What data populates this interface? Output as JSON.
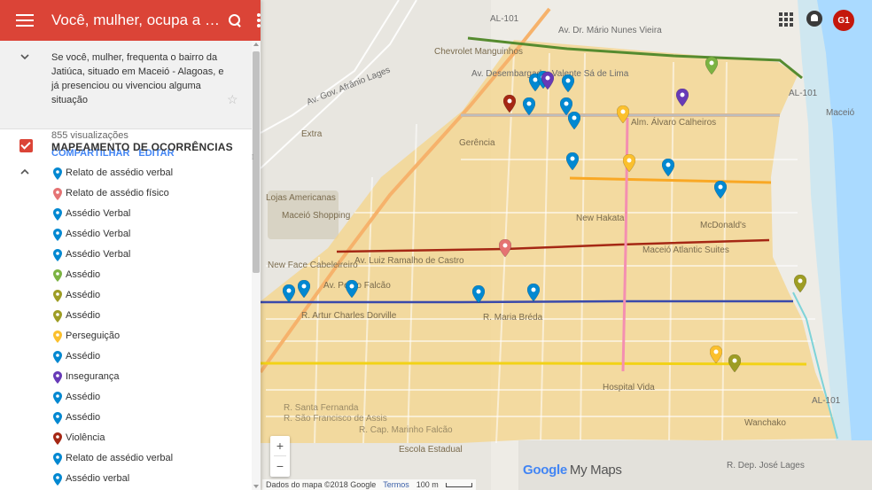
{
  "panel": {
    "title": "Você, mulher, ocupa a Jatiúca?",
    "description": "Se você, mulher, frequenta o bairro da Jatiúca, situado em Maceió - Alagoas, e já presenciou ou vivenciou alguma situação",
    "views": "855 visualizações",
    "share_label": "COMPARTILHAR",
    "edit_label": "EDITAR",
    "layer_title": "MAPEAMENTO DE OCORRÊNCIAS",
    "items": [
      {
        "label": "Relato de assédio verbal",
        "color": "#0288d1"
      },
      {
        "label": "Relato de assédio físico",
        "color": "#e57373"
      },
      {
        "label": "Assédio Verbal",
        "color": "#0288d1"
      },
      {
        "label": "Assédio Verbal",
        "color": "#0288d1"
      },
      {
        "label": "Assédio Verbal",
        "color": "#0288d1"
      },
      {
        "label": "Assédio",
        "color": "#7cb342"
      },
      {
        "label": "Assédio",
        "color": "#9e9d24"
      },
      {
        "label": "Assédio",
        "color": "#9e9d24"
      },
      {
        "label": "Perseguição",
        "color": "#fbc02d"
      },
      {
        "label": "Assédio",
        "color": "#0288d1"
      },
      {
        "label": "Insegurança",
        "color": "#673ab7"
      },
      {
        "label": "Assédio",
        "color": "#0288d1"
      },
      {
        "label": "Assédio",
        "color": "#0288d1"
      },
      {
        "label": "Violência",
        "color": "#a52714"
      },
      {
        "label": "Relato de assédio verbal",
        "color": "#0288d1"
      },
      {
        "label": "Assédio verbal",
        "color": "#0288d1"
      }
    ]
  },
  "map": {
    "g1_logo": "G1",
    "zoom_in": "+",
    "zoom_out": "−",
    "google_logo": "Google",
    "mymaps_label": "My Maps",
    "attribution": "Dados do mapa ©2018 Google",
    "terms": "Termos",
    "scale": "100 m",
    "labels": {
      "al101_top": "AL-101",
      "av_dr_mario_nunes": "Av. Dr. Mário Nunes Vieira",
      "av_gov_afranio": "Av. Gov. Afrânio Lages",
      "av_desembargador": "Av. Desembargador Valente Sá de Lima",
      "alm_alvaro": "Alm. Álvaro Calheiros",
      "al101_mid": "AL-101",
      "av_luiz_ramalho": "Av. Luiz Ramalho de Castro",
      "r_artur_charles": "R. Artur Charles Dorville",
      "r_maria_breda": "R. Maria Bréda",
      "r_jose_lages": "R. Dep. José Lages",
      "r_sao_francisco": "R. São Francisco de Assis",
      "r_santa_fernanda": "R. Santa Fernanda",
      "al101_bottom": "AL-101",
      "r_marinho_falcao": "R. Cap. Marinho Falcão",
      "av_pedro_falcao": "Av. Pedro Falcão",
      "maceio_top": "Maceió",
      "extra": "Extra",
      "lojas_americanas": "Lojas Americanas",
      "shopping": "Maceió Shopping",
      "new_face": "New Face Cabeleireiro",
      "mcdonalds": "McDonald's",
      "new_hakata": "New Hakata",
      "maceio_atlantic": "Maceió Atlantic Suites",
      "escola": "Escola Estadual",
      "hospital_vida": "Hospital Vida",
      "wanchako": "Wanchako",
      "gerencia": "Gerência",
      "chevrolet": "Chevrolet Manguinhos"
    }
  },
  "colors": {
    "header": "#db4437",
    "overlay": "#f5d58c",
    "line_green": "#558b2f",
    "line_red": "#a52714",
    "line_orange": "#f9a825",
    "line_blue": "#3949ab",
    "line_yellow": "#f2d216",
    "line_pink": "#f48fb1",
    "line_gray": "#bdbdbd"
  }
}
